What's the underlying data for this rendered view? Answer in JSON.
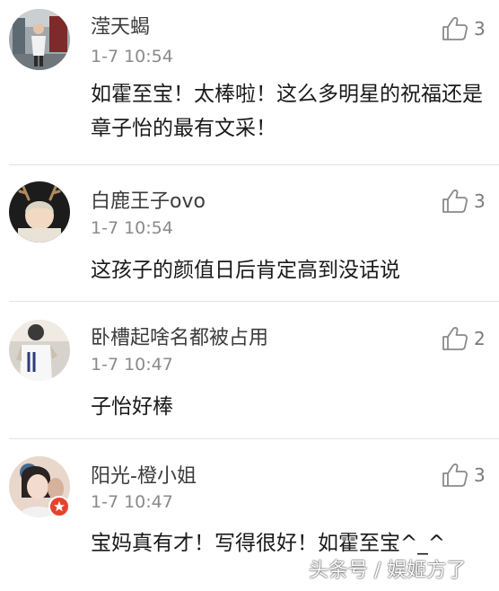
{
  "colors": {
    "username": "#3c3c3c",
    "time": "#8a8a8a",
    "content": "#1a1a1a",
    "like": "#7a7a7a",
    "divider": "#e2e2e2",
    "badge": "#e8412c"
  },
  "comments": [
    {
      "username": "滢天蝎",
      "time": "1-7 10:54",
      "likes": "3",
      "text": "如霍至宝！太棒啦！这么多明星的祝福还是章子怡的最有文采！",
      "avatar_icon": "person-street-photo-avatar"
    },
    {
      "username": "白鹿王子ovo",
      "time": "1-7 10:54",
      "likes": "3",
      "text": "这孩子的颜值日后肯定高到没话说",
      "avatar_icon": "deer-antlers-avatar"
    },
    {
      "username": "卧槽起啥名都被占用",
      "time": "1-7 10:47",
      "likes": "2",
      "text": "子怡好棒",
      "avatar_icon": "jersey-avatar"
    },
    {
      "username": "阳光-橙小姐",
      "time": "1-7 10:47",
      "likes": "3",
      "text": "宝妈真有才！写得很好！如霍至宝^_^",
      "avatar_icon": "girl-avatar",
      "badge_icon": "star-badge-icon"
    }
  ],
  "watermark": "头条号 / 娱姬方了"
}
